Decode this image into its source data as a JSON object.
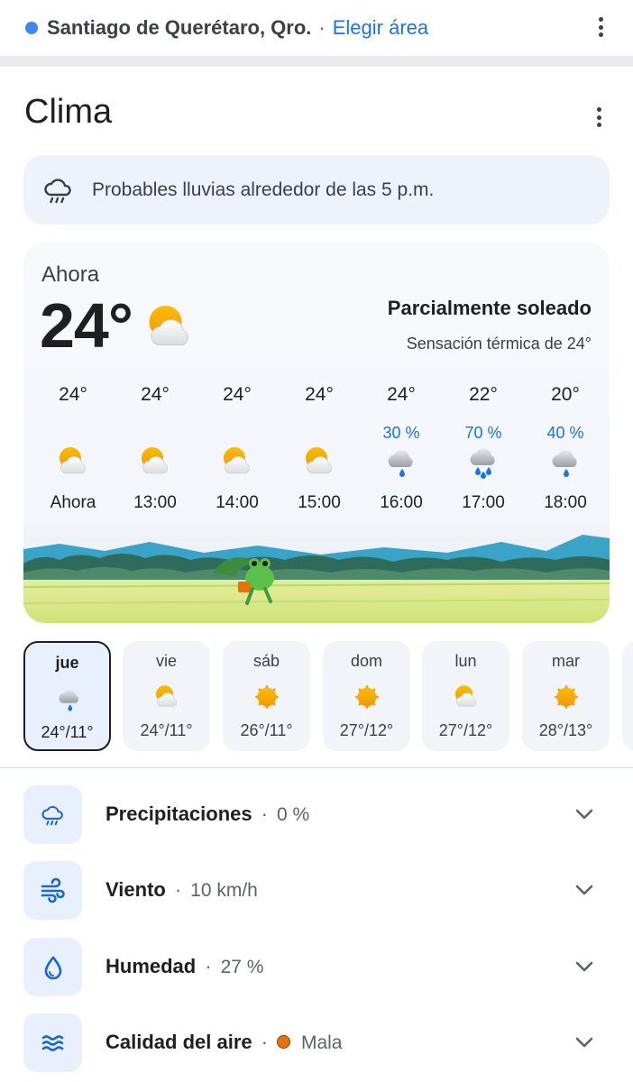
{
  "location": {
    "name": "Santiago de Querétaro, Qro.",
    "separator": "·",
    "link": "Elegir área",
    "menu_icon": "more-vert-icon"
  },
  "header": {
    "title": "Clima",
    "menu_icon": "more-vert-icon"
  },
  "alert": {
    "icon": "rain-cloud-icon",
    "text": "Probables lluvias alrededor de las 5 p.m."
  },
  "current": {
    "label": "Ahora",
    "temp": "24°",
    "icon": "partly-sunny-icon",
    "condition": "Parcialmente soleado",
    "feels_like": "Sensación térmica de 24°"
  },
  "hourly": [
    {
      "temp": "24°",
      "precip": "",
      "icon": "partly-sunny-icon",
      "time": "Ahora"
    },
    {
      "temp": "24°",
      "precip": "",
      "icon": "partly-sunny-icon",
      "time": "13:00"
    },
    {
      "temp": "24°",
      "precip": "",
      "icon": "partly-sunny-icon",
      "time": "14:00"
    },
    {
      "temp": "24°",
      "precip": "",
      "icon": "partly-sunny-icon",
      "time": "15:00"
    },
    {
      "temp": "24°",
      "precip": "30 %",
      "icon": "rain-icon",
      "time": "16:00"
    },
    {
      "temp": "22°",
      "precip": "70 %",
      "icon": "heavy-rain-icon",
      "time": "17:00"
    },
    {
      "temp": "20°",
      "precip": "40 %",
      "icon": "rain-icon",
      "time": "18:00"
    }
  ],
  "daily": [
    {
      "day": "jue",
      "icon": "rain-icon",
      "temps": "24°/11°",
      "selected": true
    },
    {
      "day": "vie",
      "icon": "partly-sunny-icon",
      "temps": "24°/11°"
    },
    {
      "day": "sáb",
      "icon": "sunny-icon",
      "temps": "26°/11°"
    },
    {
      "day": "dom",
      "icon": "sunny-icon",
      "temps": "27°/12°"
    },
    {
      "day": "lun",
      "icon": "partly-sunny-icon",
      "temps": "27°/12°"
    },
    {
      "day": "mar",
      "icon": "sunny-icon",
      "temps": "28°/13°"
    }
  ],
  "details": [
    {
      "label": "Precipitaciones",
      "separator": "·",
      "value": "0 %",
      "icon": "rain-cloud-icon"
    },
    {
      "label": "Viento",
      "separator": "·",
      "value": "10 km/h",
      "icon": "wind-icon"
    },
    {
      "label": "Humedad",
      "separator": "·",
      "value": "27 %",
      "icon": "water-drop-icon"
    },
    {
      "label": "Calidad del aire",
      "separator": "·",
      "value": "Mala",
      "icon": "air-quality-icon"
    }
  ],
  "colors": {
    "accent": "#1a73e8",
    "aqi_mala": "#e8710a",
    "card_bg": "#f1f4f9"
  }
}
